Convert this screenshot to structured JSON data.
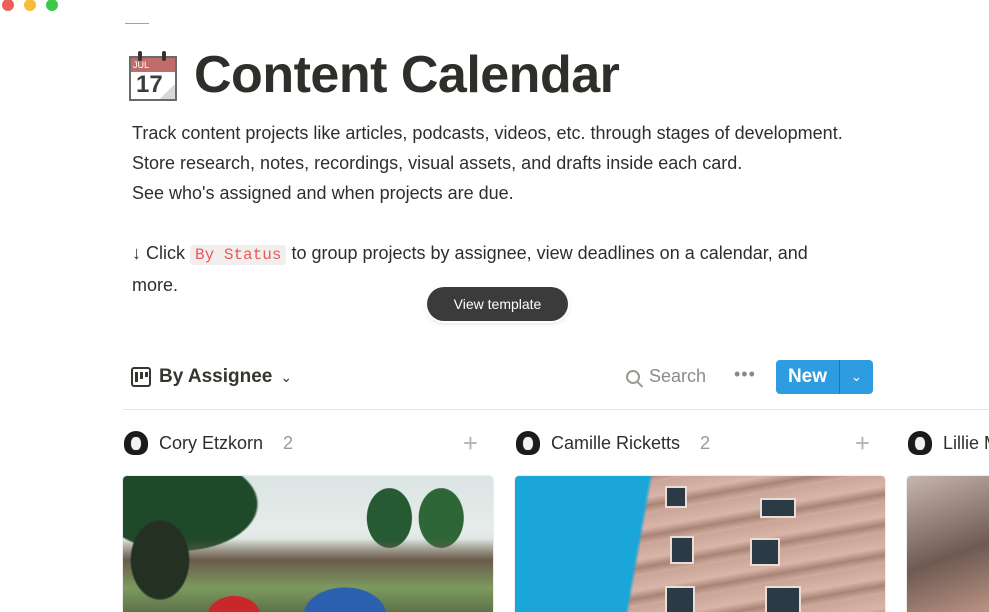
{
  "window": {
    "controls": [
      "close",
      "minimize",
      "maximize"
    ]
  },
  "page": {
    "icon": "calendar-icon",
    "icon_month": "JUL",
    "icon_day": "17",
    "title": "Content Calendar",
    "description": [
      "Track content projects like articles, podcasts, videos, etc. through stages of development.",
      "Store research, notes, recordings, visual assets, and drafts inside each card.",
      "See who's assigned and when projects are due."
    ],
    "hint": {
      "arrow": "↓",
      "prefix": "Click",
      "code": "By Status",
      "suffix": "to group projects by assignee, view deadlines on a calendar, and more."
    }
  },
  "tooltip": {
    "label": "View template"
  },
  "view_bar": {
    "view_icon": "board-icon",
    "view_name": "By Assignee",
    "view_chevron": "⌄",
    "search_label": "Search",
    "more_label": "•••",
    "new_label": "New",
    "new_dropdown": "⌄"
  },
  "board": {
    "columns": [
      {
        "name": "Cory Etzkorn",
        "count": "2",
        "add": "+",
        "cover": "festival-crowd-image"
      },
      {
        "name": "Camille Ricketts",
        "count": "2",
        "add": "+",
        "cover": "building-facade-image"
      },
      {
        "name": "Lillie M",
        "count": "",
        "add": "",
        "cover": "partial-cover-image"
      }
    ]
  },
  "colors": {
    "accent": "#2e9ce0",
    "code_text": "#eb5757",
    "code_bg": "#f0efed",
    "text": "#2f2e2b",
    "muted": "#9b9a97"
  }
}
